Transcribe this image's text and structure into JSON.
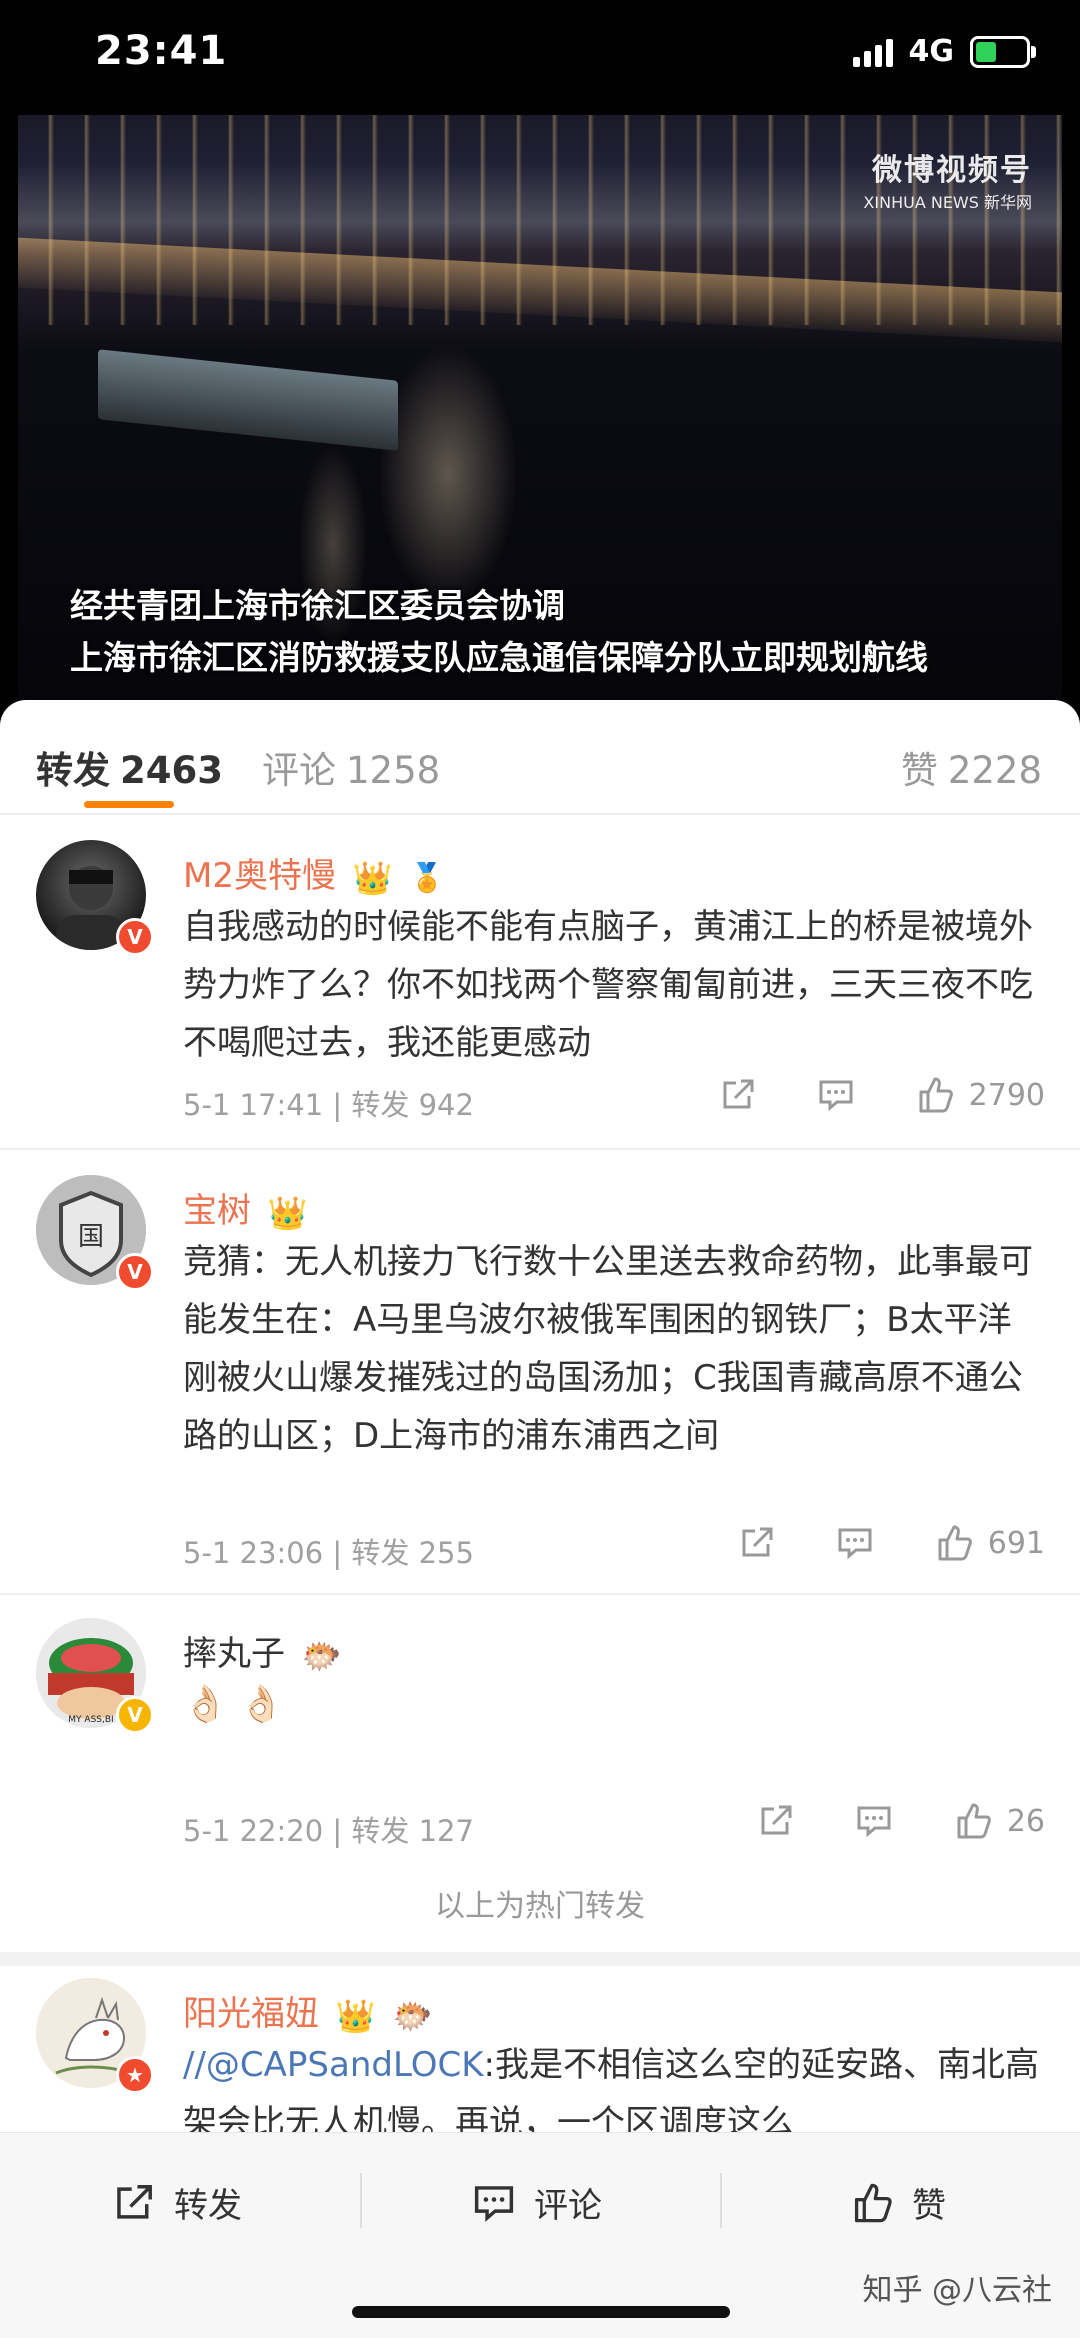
{
  "status": {
    "time": "23:41",
    "network": "4G"
  },
  "video": {
    "logo_main": "微博视频号",
    "logo_sub": "XINHUA NEWS 新华网",
    "subtitle_line1": "经共青团上海市徐汇区委员会协调",
    "subtitle_line2": "上海市徐汇区消防救援支队应急通信保障分队立即规划航线"
  },
  "tabs": {
    "repost": {
      "label": "转发",
      "count": "2463"
    },
    "comment": {
      "label": "评论",
      "count": "1258"
    },
    "like": {
      "label": "赞",
      "count": "2228"
    }
  },
  "comments": [
    {
      "name": "M2奥特慢",
      "text": "自我感动的时候能不能有点脑子，黄浦江上的桥是被境外势力炸了么？你不如找两个警察匍匐前进，三天三夜不吃不喝爬过去，我还能更感动",
      "meta": "5-1 17:41 | 转发 942",
      "likes": "2790",
      "badge_color": "#f04a2f"
    },
    {
      "name": "宝树",
      "text": "竞猜：无人机接力飞行数十公里送去救命药物，此事最可能发生在：A马里乌波尔被俄军围困的钢铁厂；B太平洋刚被火山爆发摧残过的岛国汤加；C我国青藏高原不通公路的山区；D上海市的浦东浦西之间",
      "meta": "5-1 23:06 | 转发 255",
      "likes": "691",
      "badge_color": "#f04a2f"
    },
    {
      "name": "摔丸子",
      "text": "👌🏻 👌🏻",
      "meta": "5-1 22:20 | 转发 127",
      "likes": "26",
      "avatar_text": "MY ASS,BI",
      "badge_color": "#f7b500"
    },
    {
      "name": "阳光福妞",
      "text_mention": "//@CAPSandLOCK",
      "text": ":我是不相信这么空的延安路、南北高架会比无人机慢。再说，一个区调度这么",
      "badge_color": "#f04a2f"
    }
  ],
  "hot_end_label": "以上为热门转发",
  "bottom_bar": {
    "repost": "转发",
    "comment": "评论",
    "like": "赞"
  },
  "watermark": "知乎 @八云社",
  "colors": {
    "accent": "#ff8200",
    "username": "#eb7350",
    "mention": "#4c77b5"
  }
}
